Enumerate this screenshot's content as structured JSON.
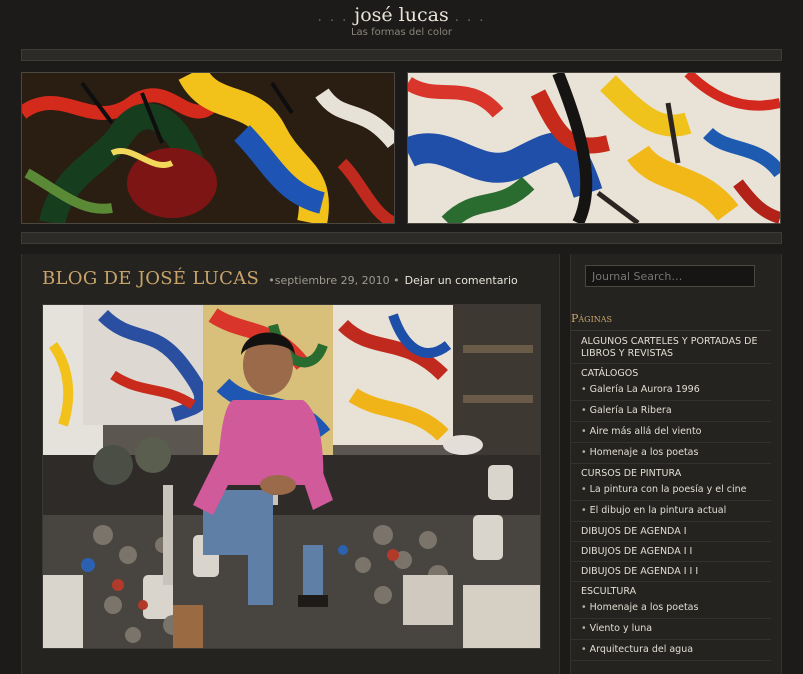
{
  "site": {
    "title_dots_left": ". . .",
    "title": "josé lucas",
    "title_dots_right": ". . .",
    "tagline": "Las formas del color"
  },
  "post": {
    "title": "BLOG DE JOSÉ LUCAS",
    "date": "•septiembre 29, 2010 •",
    "comments": "Dejar un comentario"
  },
  "sidebar": {
    "search_placeholder": "Journal Search…",
    "pages_heading": "Páginas",
    "items": [
      {
        "label": "ALGUNOS CARTELES Y PORTADAS DE LIBROS Y REVISTAS"
      },
      {
        "label": "CATÁLOGOS",
        "children": [
          "Galería La Aurora 1996",
          "Galería La Ribera",
          "Aire más allá del viento",
          "Homenaje a los poetas"
        ]
      },
      {
        "label": "CURSOS DE PINTURA",
        "children": [
          "La pintura con la poesía y el cine",
          "El dibujo en la pintura actual"
        ]
      },
      {
        "label": "DIBUJOS DE AGENDA I"
      },
      {
        "label": "DIBUJOS DE AGENDA I I"
      },
      {
        "label": "DIBUJOS DE AGENDA I I I"
      },
      {
        "label": "ESCULTURA",
        "children": [
          "Homenaje a los poetas",
          "Viento y luna",
          "Arquitectura del agua"
        ]
      }
    ]
  },
  "icons": {
    "bullet": "•"
  },
  "colors": {
    "background": "#1c1b19",
    "accent_gold": "#c9a46a",
    "panel": "#242320"
  }
}
